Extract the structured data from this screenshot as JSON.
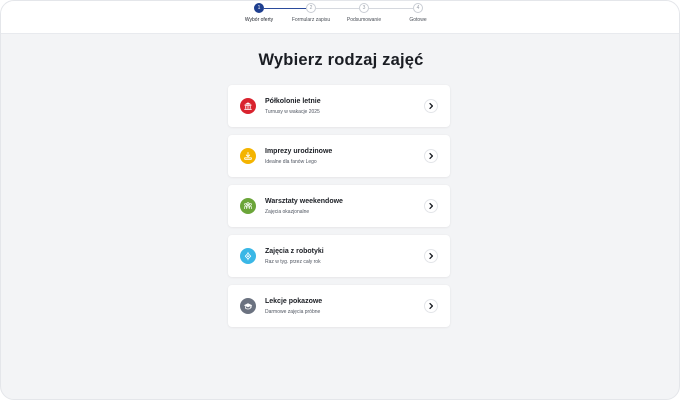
{
  "stepper": {
    "steps": [
      {
        "number": "1",
        "label": "Wybór oferty",
        "active": true
      },
      {
        "number": "2",
        "label": "Formularz zapisu",
        "active": false
      },
      {
        "number": "3",
        "label": "Podsumowanie",
        "active": false
      },
      {
        "number": "4",
        "label": "Gotowe",
        "active": false
      }
    ]
  },
  "page": {
    "title": "Wybierz rodzaj zajęć"
  },
  "offers": [
    {
      "title": "Półkolonie letnie",
      "subtitle": "Turnusy w wakacje 2025",
      "icon": "building-icon",
      "color": "#d9232e"
    },
    {
      "title": "Imprezy urodzinowe",
      "subtitle": "Idealne dla fanów Lego",
      "icon": "gift-icon",
      "color": "#f4b400"
    },
    {
      "title": "Warsztaty weekendowe",
      "subtitle": "Zajęcia okazjonalne",
      "icon": "group-icon",
      "color": "#6ba539"
    },
    {
      "title": "Zajęcia z robotyki",
      "subtitle": "Raz w tyg. przez cały rok",
      "icon": "robot-icon",
      "color": "#3ab7e6"
    },
    {
      "title": "Lekcje pokazowe",
      "subtitle": "Darmowe zajęcia próbne",
      "icon": "graduation-cap-icon",
      "color": "#6b7280"
    }
  ],
  "colors": {
    "accent": "#1f3f8f",
    "background": "#f3f4f6"
  }
}
